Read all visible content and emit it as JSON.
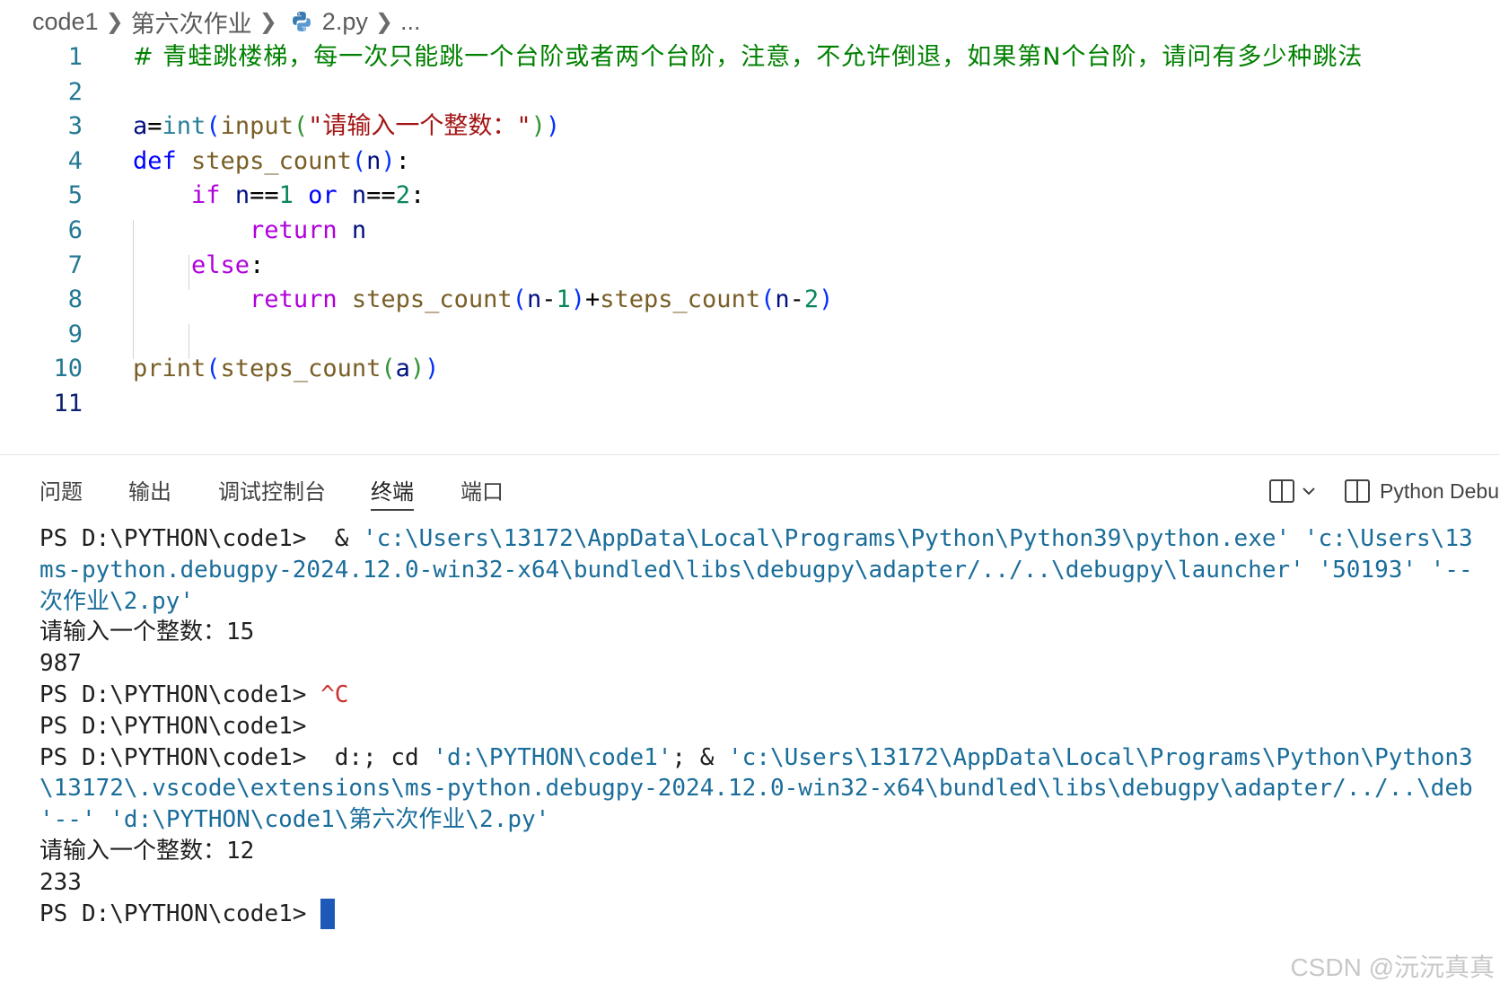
{
  "breadcrumb": {
    "root": "code1",
    "folder": "第六次作业",
    "file": "2.py",
    "more": "..."
  },
  "editor": {
    "active_line": 11,
    "lines": [
      {
        "n": "1",
        "tokens": [
          {
            "t": "# 青蛙跳楼梯，每一次只能跳一个台阶或者两个台阶，注意，不允许倒退，如果第N个台阶，请问有多少种跳法",
            "c": "cmt"
          }
        ]
      },
      {
        "n": "2",
        "tokens": []
      },
      {
        "n": "3",
        "tokens": [
          {
            "t": "a",
            "c": "var"
          },
          {
            "t": "=",
            "c": "op"
          },
          {
            "t": "int",
            "c": "bi"
          },
          {
            "t": "(",
            "c": "p1"
          },
          {
            "t": "input",
            "c": "fn"
          },
          {
            "t": "(",
            "c": "p2"
          },
          {
            "t": "\"请输入一个整数：\"",
            "c": "str"
          },
          {
            "t": ")",
            "c": "p2"
          },
          {
            "t": ")",
            "c": "p1"
          }
        ]
      },
      {
        "n": "4",
        "tokens": [
          {
            "t": "def",
            "c": "kw"
          },
          {
            "t": " ",
            "c": "op"
          },
          {
            "t": "steps_count",
            "c": "fn"
          },
          {
            "t": "(",
            "c": "p1"
          },
          {
            "t": "n",
            "c": "var"
          },
          {
            "t": ")",
            "c": "p1"
          },
          {
            "t": ":",
            "c": "op"
          }
        ]
      },
      {
        "n": "5",
        "tokens": [
          {
            "t": "    ",
            "c": "op"
          },
          {
            "t": "if",
            "c": "ctl"
          },
          {
            "t": " ",
            "c": "op"
          },
          {
            "t": "n",
            "c": "var"
          },
          {
            "t": "==",
            "c": "op"
          },
          {
            "t": "1",
            "c": "num"
          },
          {
            "t": " ",
            "c": "op"
          },
          {
            "t": "or",
            "c": "kw"
          },
          {
            "t": " ",
            "c": "op"
          },
          {
            "t": "n",
            "c": "var"
          },
          {
            "t": "==",
            "c": "op"
          },
          {
            "t": "2",
            "c": "num"
          },
          {
            "t": ":",
            "c": "op"
          }
        ]
      },
      {
        "n": "6",
        "tokens": [
          {
            "t": "        ",
            "c": "op"
          },
          {
            "t": "return",
            "c": "ctl"
          },
          {
            "t": " ",
            "c": "op"
          },
          {
            "t": "n",
            "c": "var"
          }
        ]
      },
      {
        "n": "7",
        "tokens": [
          {
            "t": "    ",
            "c": "op"
          },
          {
            "t": "else",
            "c": "ctl"
          },
          {
            "t": ":",
            "c": "op"
          }
        ]
      },
      {
        "n": "8",
        "tokens": [
          {
            "t": "        ",
            "c": "op"
          },
          {
            "t": "return",
            "c": "ctl"
          },
          {
            "t": " ",
            "c": "op"
          },
          {
            "t": "steps_count",
            "c": "fn"
          },
          {
            "t": "(",
            "c": "p1"
          },
          {
            "t": "n",
            "c": "var"
          },
          {
            "t": "-",
            "c": "op"
          },
          {
            "t": "1",
            "c": "num"
          },
          {
            "t": ")",
            "c": "p1"
          },
          {
            "t": "+",
            "c": "op"
          },
          {
            "t": "steps_count",
            "c": "fn"
          },
          {
            "t": "(",
            "c": "p1"
          },
          {
            "t": "n",
            "c": "var"
          },
          {
            "t": "-",
            "c": "op"
          },
          {
            "t": "2",
            "c": "num"
          },
          {
            "t": ")",
            "c": "p1"
          }
        ]
      },
      {
        "n": "9",
        "tokens": []
      },
      {
        "n": "10",
        "tokens": [
          {
            "t": "print",
            "c": "fn"
          },
          {
            "t": "(",
            "c": "p1"
          },
          {
            "t": "steps_count",
            "c": "fn"
          },
          {
            "t": "(",
            "c": "p2"
          },
          {
            "t": "a",
            "c": "var"
          },
          {
            "t": ")",
            "c": "p2"
          },
          {
            "t": ")",
            "c": "p1"
          }
        ]
      },
      {
        "n": "11",
        "tokens": []
      }
    ]
  },
  "panel": {
    "tabs": [
      {
        "label": "问题",
        "active": false
      },
      {
        "label": "输出",
        "active": false
      },
      {
        "label": "调试控制台",
        "active": false
      },
      {
        "label": "终端",
        "active": true
      },
      {
        "label": "端口",
        "active": false
      }
    ],
    "terminal_name": "Python Debu"
  },
  "terminal": {
    "lines": [
      [
        {
          "t": "PS D:\\PYTHON\\code1>  & ",
          "c": ""
        },
        {
          "t": "'c:\\Users\\13172\\AppData\\Local\\Programs\\Python\\Python39\\python.exe' 'c:\\Users\\13",
          "c": "ts"
        }
      ],
      [
        {
          "t": "ms-python.debugpy-2024.12.0-win32-x64\\bundled\\libs\\debugpy\\adapter/../..\\debugpy\\launcher' '50193' '--",
          "c": "ts"
        }
      ],
      [
        {
          "t": "次作业\\2.py'",
          "c": "ts"
        }
      ],
      [
        {
          "t": "请输入一个整数：15",
          "c": ""
        }
      ],
      [
        {
          "t": "987",
          "c": ""
        }
      ],
      [
        {
          "t": "PS D:\\PYTHON\\code1> ",
          "c": ""
        },
        {
          "t": "^C",
          "c": "tr"
        }
      ],
      [
        {
          "t": "PS D:\\PYTHON\\code1>",
          "c": ""
        }
      ],
      [
        {
          "t": "PS D:\\PYTHON\\code1>  d:; cd ",
          "c": ""
        },
        {
          "t": "'d:\\PYTHON\\code1'",
          "c": "ts"
        },
        {
          "t": "; & ",
          "c": ""
        },
        {
          "t": "'c:\\Users\\13172\\AppData\\Local\\Programs\\Python\\Python3",
          "c": "ts"
        }
      ],
      [
        {
          "t": "\\13172\\.vscode\\extensions\\ms-python.debugpy-2024.12.0-win32-x64\\bundled\\libs\\debugpy\\adapter/../..\\deb",
          "c": "ts"
        }
      ],
      [
        {
          "t": "'--' 'd:\\PYTHON\\code1\\第六次作业\\2.py'",
          "c": "ts"
        }
      ],
      [
        {
          "t": "请输入一个整数：12",
          "c": ""
        }
      ],
      [
        {
          "t": "233",
          "c": ""
        }
      ],
      [
        {
          "t": "PS D:\\PYTHON\\code1> ",
          "c": ""
        }
      ]
    ]
  },
  "watermark": "CSDN @沅沅真真"
}
